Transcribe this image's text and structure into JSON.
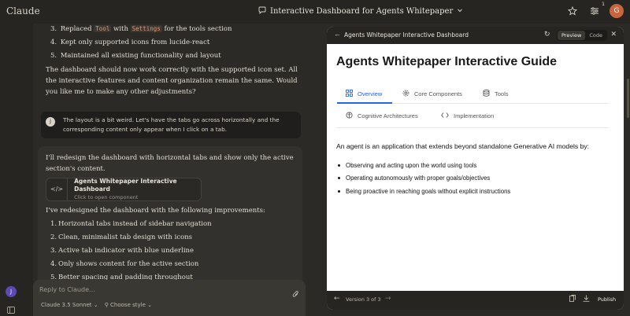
{
  "app": {
    "brand": "Claude"
  },
  "topbar": {
    "conversation_title": "Interactive Dashboard for Agents Whitepaper",
    "notification_count": "1",
    "avatar_initial": "G"
  },
  "rail": {
    "avatar_initial": "J"
  },
  "chat": {
    "list1": [
      {
        "num": "3.",
        "pre": "Replaced ",
        "code1": "Tool",
        "mid": " with ",
        "code2": "Settings",
        "post": " for the tools section"
      },
      {
        "num": "4.",
        "text": "Kept only supported icons from lucide-react"
      },
      {
        "num": "5.",
        "text": "Maintained all existing functionality and layout"
      }
    ],
    "para1": "The dashboard should now work correctly with the supported icon set. All the interactive features and content organization remain the same. Would you like me to make any other adjustments?",
    "user_message": "The layout is a bit weird. Let's have the tabs go across horizontally and the corresponding content only appear when I click on a tab.",
    "user_initial": "J",
    "para2": "I'll redesign the dashboard with horizontal tabs and show only the active section's content.",
    "artifact": {
      "title": "Agents Whitepaper Interactive Dashboard",
      "subtitle": "Click to open component"
    },
    "para3": "I've redesigned the dashboard with the following improvements:",
    "list2": [
      {
        "num": "1.",
        "text": "Horizontal tabs instead of sidebar navigation"
      },
      {
        "num": "2.",
        "text": "Clean, minimalist tab design with icons"
      },
      {
        "num": "3.",
        "text": "Active tab indicator with blue underline"
      },
      {
        "num": "4.",
        "text": "Only shows content for the active section"
      },
      {
        "num": "5.",
        "text": "Better spacing and padding throughout"
      }
    ],
    "reply_placeholder": "Reply to Claude...",
    "model_label": "Claude 3.5 Sonnet",
    "style_label": "Choose style"
  },
  "panel": {
    "header_title": "Agents Whitepaper Interactive Dashboard",
    "preview_label": "Preview",
    "code_label": "Code",
    "doc_title": "Agents Whitepaper Interactive Guide",
    "tabs": [
      {
        "label": "Overview",
        "icon": "grid-icon",
        "active": true
      },
      {
        "label": "Core Components",
        "icon": "gear-icon"
      },
      {
        "label": "Tools",
        "icon": "database-icon"
      },
      {
        "label": "Cognitive Architectures",
        "icon": "brain-icon"
      },
      {
        "label": "Implementation",
        "icon": "code-icon"
      }
    ],
    "intro": "An agent is an application that extends beyond standalone Generative AI models by:",
    "bullets": [
      "Observing and acting upon the world using tools",
      "Operating autonomously with proper goals/objectives",
      "Being proactive in reaching goals without explicit instructions"
    ],
    "version_label": "Version 3 of 3",
    "publish_label": "Publish",
    "accent_color": "#2563eb"
  }
}
